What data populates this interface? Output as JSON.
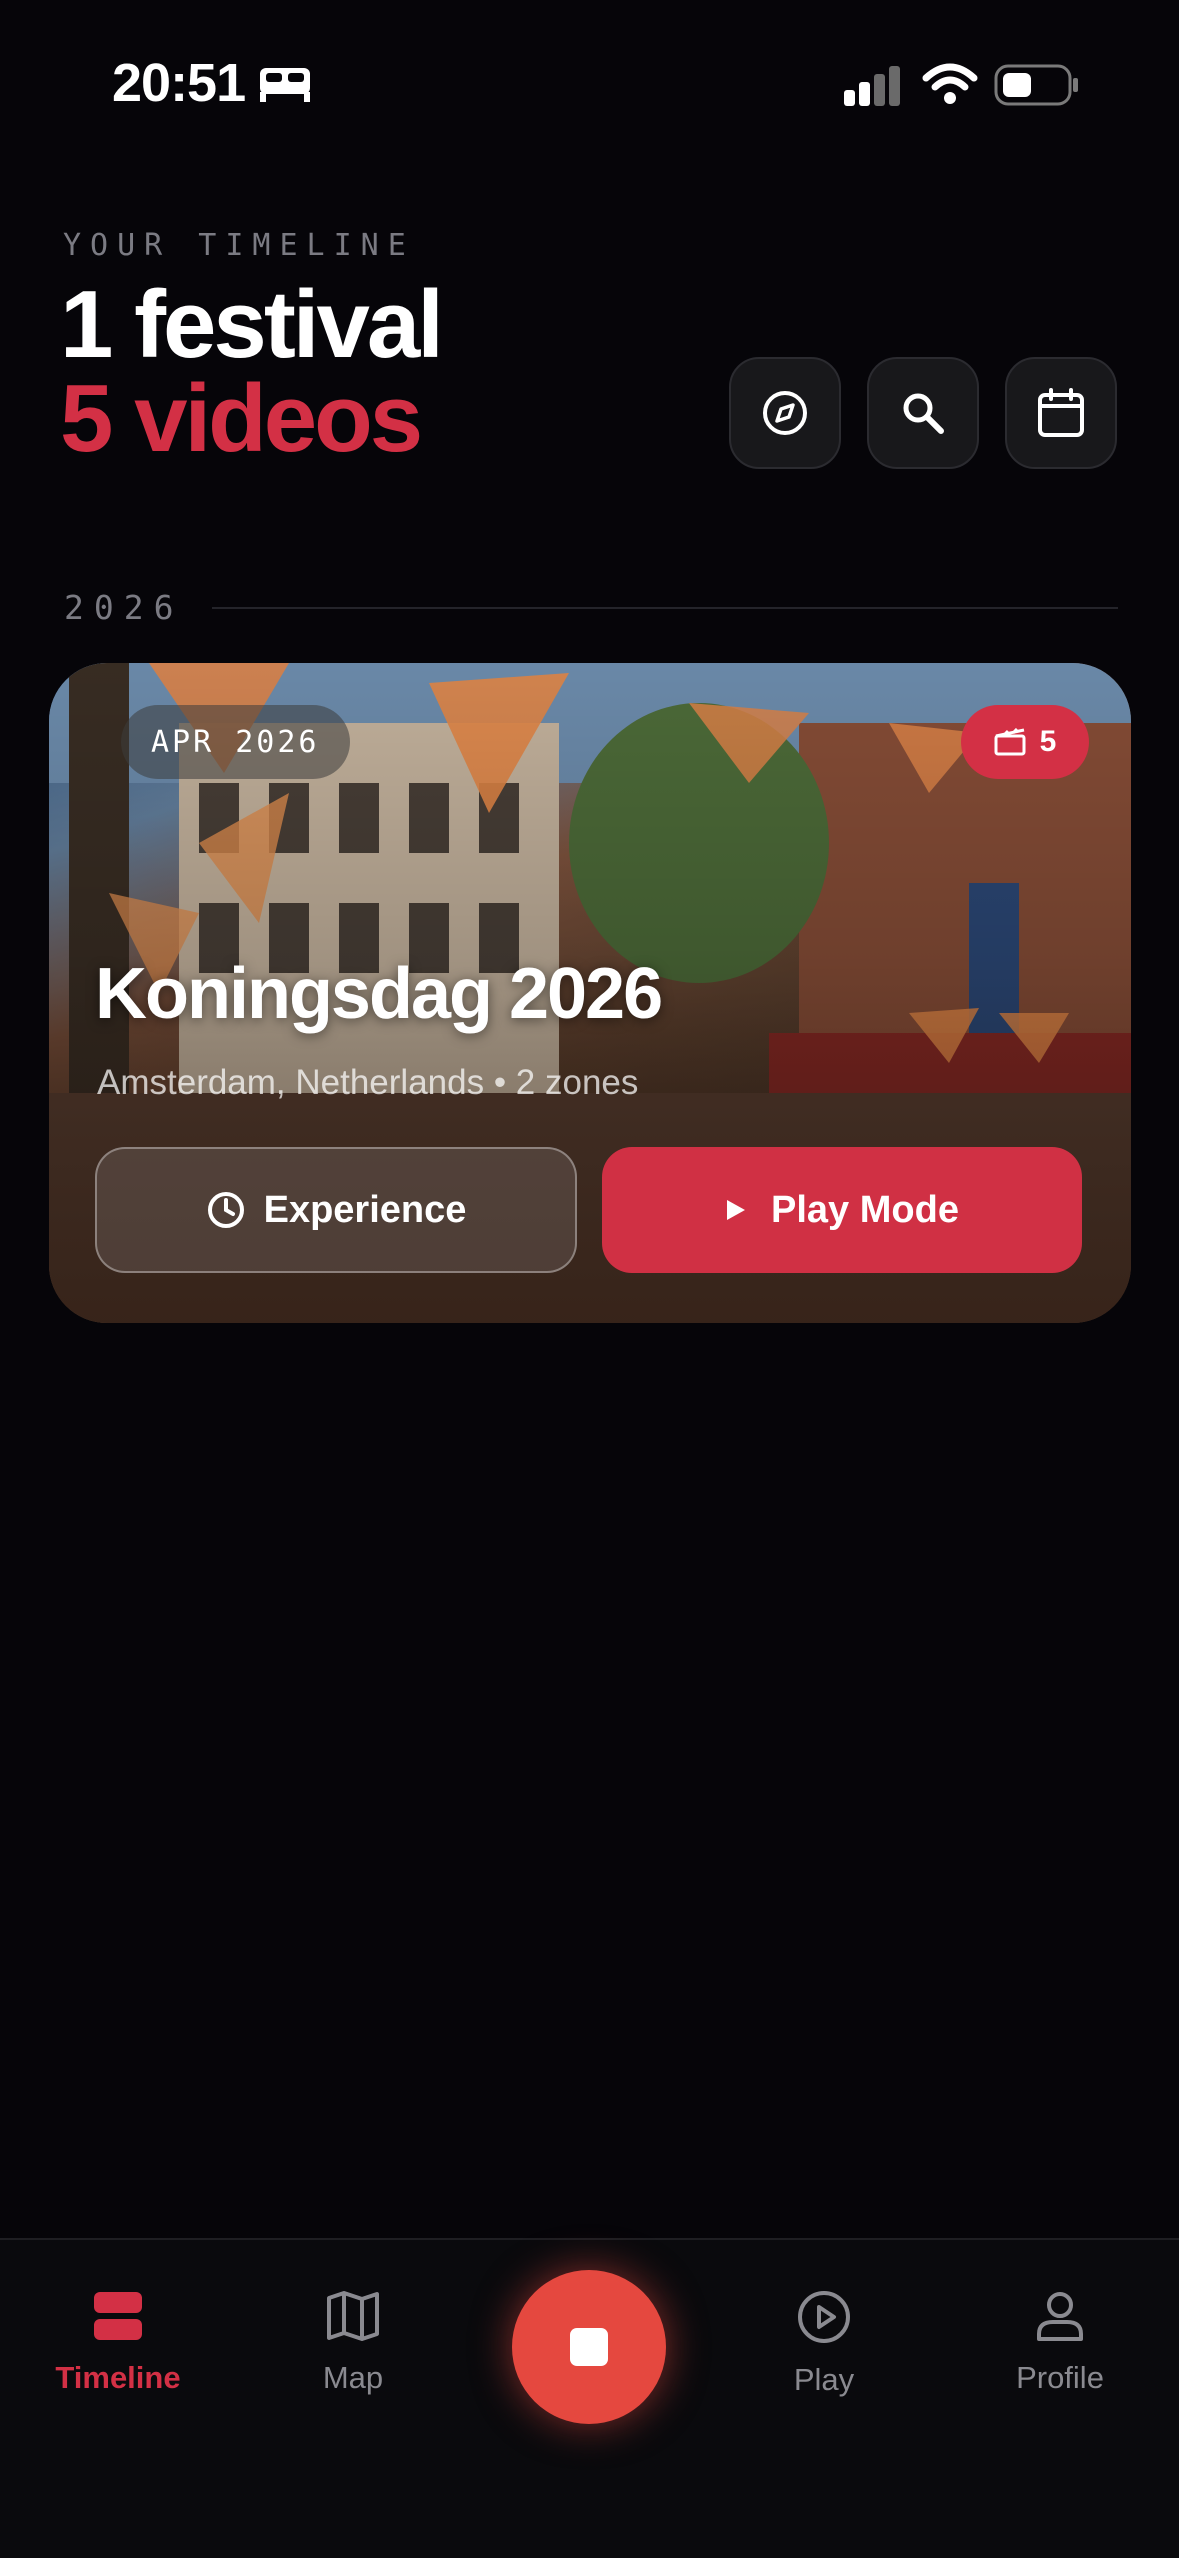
{
  "status": {
    "time": "20:51"
  },
  "header": {
    "eyebrow": "YOUR TIMELINE",
    "festivals": "1 festival",
    "videos": "5 videos"
  },
  "year": "2026",
  "card": {
    "date": "APR 2026",
    "video_count": "5",
    "title": "Koningsdag 2026",
    "subtitle": "Amsterdam, Netherlands • 2 zones",
    "experience_label": "Experience",
    "play_label": "Play Mode"
  },
  "tabs": {
    "timeline": "Timeline",
    "map": "Map",
    "play": "Play",
    "profile": "Profile"
  },
  "colors": {
    "accent": "#d33045",
    "record": "#e5483f",
    "background": "#060509"
  }
}
